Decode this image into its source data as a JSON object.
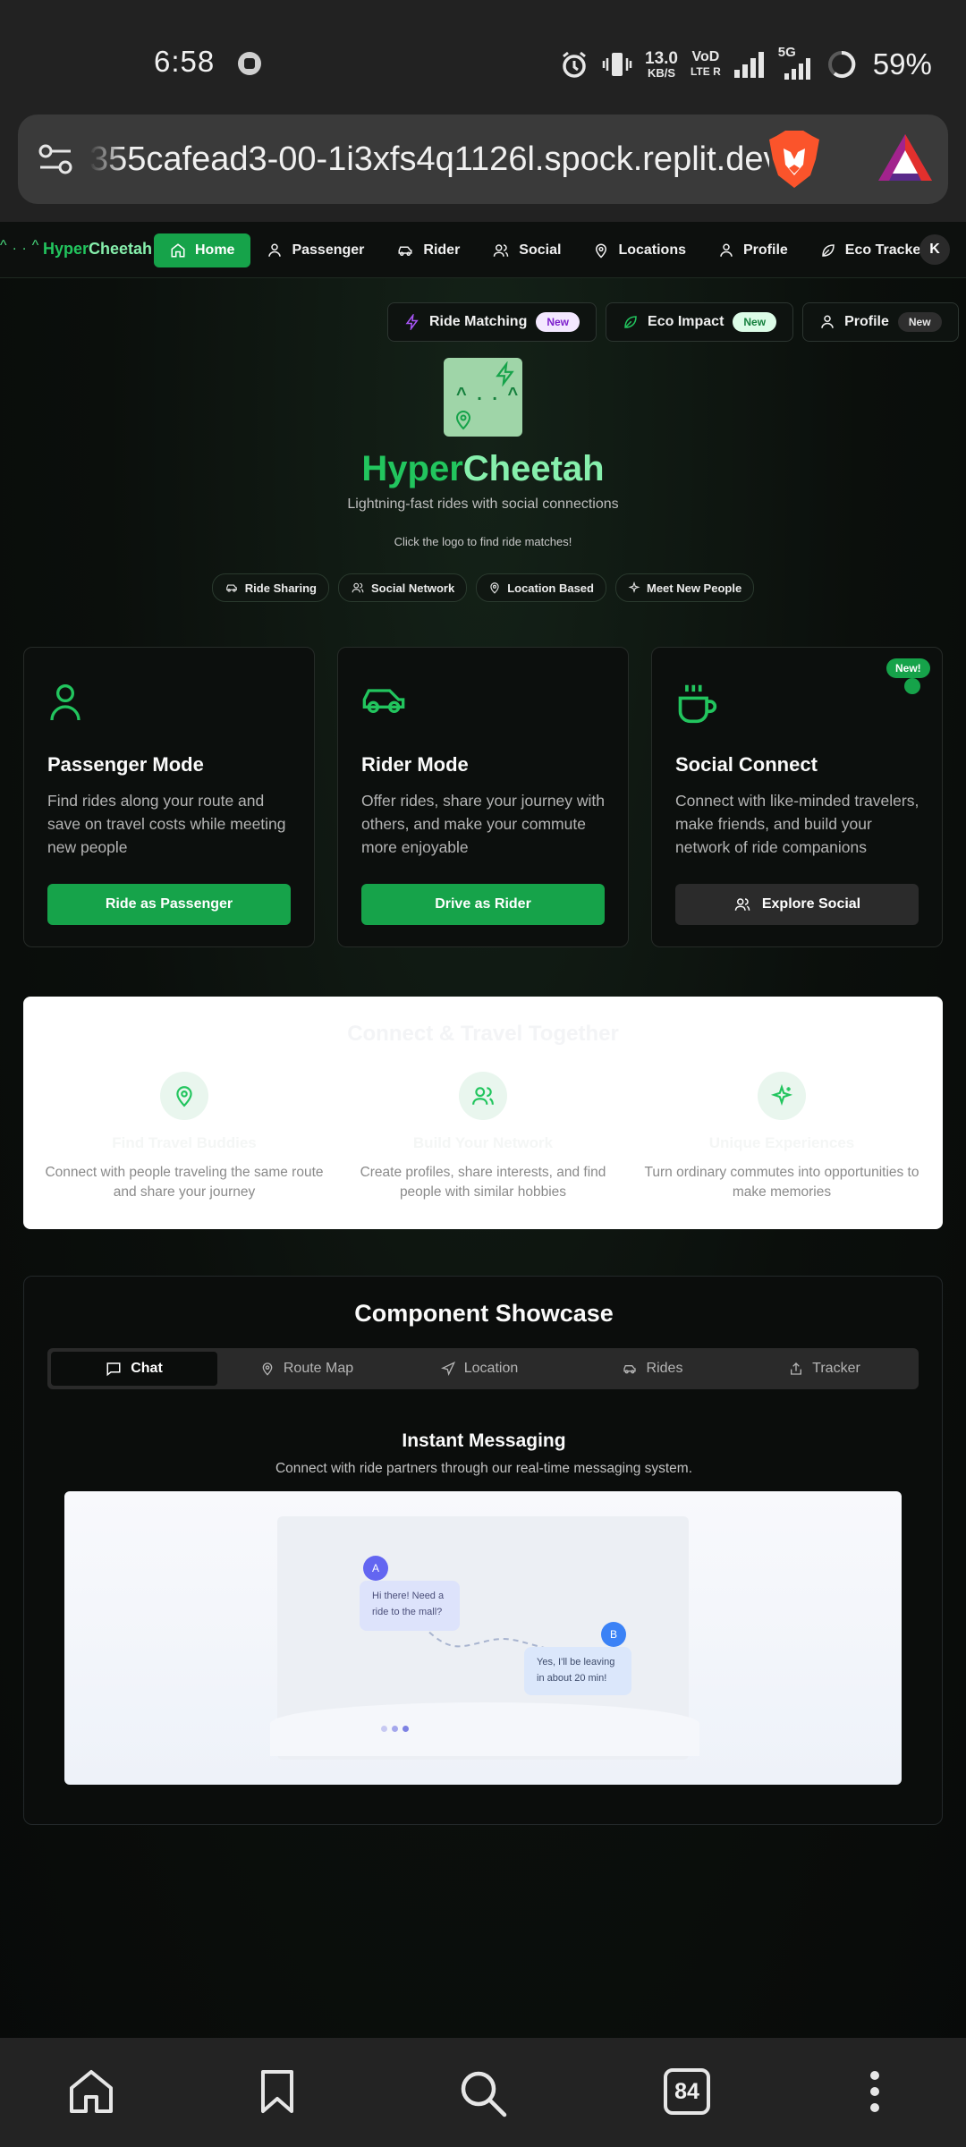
{
  "status_bar": {
    "time": "6:58",
    "net_speed_value": "13.0",
    "net_speed_unit": "KB/S",
    "volte_top": "VoD",
    "volte_bottom": "LTE R",
    "network": "5G",
    "battery": "59%"
  },
  "browser": {
    "url": "355cafead3-00-1i3xfs4q1126l.spock.replit.dev",
    "tab_count": "84"
  },
  "nav": {
    "logo_text": "^ . . ^",
    "brand_part1": "Hyper",
    "brand_part2": "Cheetah",
    "items": [
      {
        "label": "Home",
        "icon": "home-icon"
      },
      {
        "label": "Passenger",
        "icon": "user-icon"
      },
      {
        "label": "Rider",
        "icon": "car-icon"
      },
      {
        "label": "Social",
        "icon": "users-icon"
      },
      {
        "label": "Locations",
        "icon": "map-pin-icon"
      },
      {
        "label": "Profile",
        "icon": "user-icon"
      },
      {
        "label": "Eco Tracker",
        "icon": "leaf-icon"
      }
    ],
    "avatar_initial": "K"
  },
  "feature_pills": [
    {
      "label": "Ride Matching",
      "badge": "New",
      "icon": "zap-icon"
    },
    {
      "label": "Eco Impact",
      "badge": "New",
      "icon": "leaf-icon"
    },
    {
      "label": "Profile",
      "badge": "New",
      "icon": "user-icon"
    }
  ],
  "hero": {
    "logo_face": "^ . . ^",
    "title_part1": "Hyper",
    "title_part2": "Cheetah",
    "subtitle": "Lightning-fast rides with social connections",
    "hint": "Click the logo to find ride matches!",
    "tags": [
      "Ride Sharing",
      "Social Network",
      "Location Based",
      "Meet New People"
    ]
  },
  "cards": [
    {
      "title": "Passenger Mode",
      "description": "Find rides along your route and save on travel costs while meeting new people",
      "button": "Ride as Passenger",
      "icon": "user-icon"
    },
    {
      "title": "Rider Mode",
      "description": "Offer rides, share your journey with others, and make your commute more enjoyable",
      "button": "Drive as Rider",
      "icon": "car-icon"
    },
    {
      "title": "Social Connect",
      "description": "Connect with like-minded travelers, make friends, and build your network of ride companions",
      "button": "Explore Social",
      "icon": "coffee-icon",
      "badge": "New!"
    }
  ],
  "connect": {
    "title": "Connect & Travel Together",
    "columns": [
      {
        "heading": "Find Travel Buddies",
        "text": "Connect with people traveling the same route and share your journey"
      },
      {
        "heading": "Build Your Network",
        "text": "Create profiles, share interests, and find people with similar hobbies"
      },
      {
        "heading": "Unique Experiences",
        "text": "Turn ordinary commutes into opportunities to make memories"
      }
    ]
  },
  "showcase": {
    "title": "Component Showcase",
    "tabs": [
      "Chat",
      "Route Map",
      "Location",
      "Rides",
      "Tracker"
    ],
    "active_tab": "Chat",
    "section_title": "Instant Messaging",
    "section_subtitle": "Connect with ride partners through our real-time messaging system.",
    "chat": {
      "avatar_a": "A",
      "avatar_b": "B",
      "message_a_line1": "Hi there! Need a",
      "message_a_line2": "ride to the mall?",
      "message_b_line1": "Yes, I'll be leaving",
      "message_b_line2": "in about 20 min!"
    }
  },
  "colors": {
    "accent": "#16a34a",
    "accent_light": "#86efac",
    "background": "#0b0f0c"
  }
}
